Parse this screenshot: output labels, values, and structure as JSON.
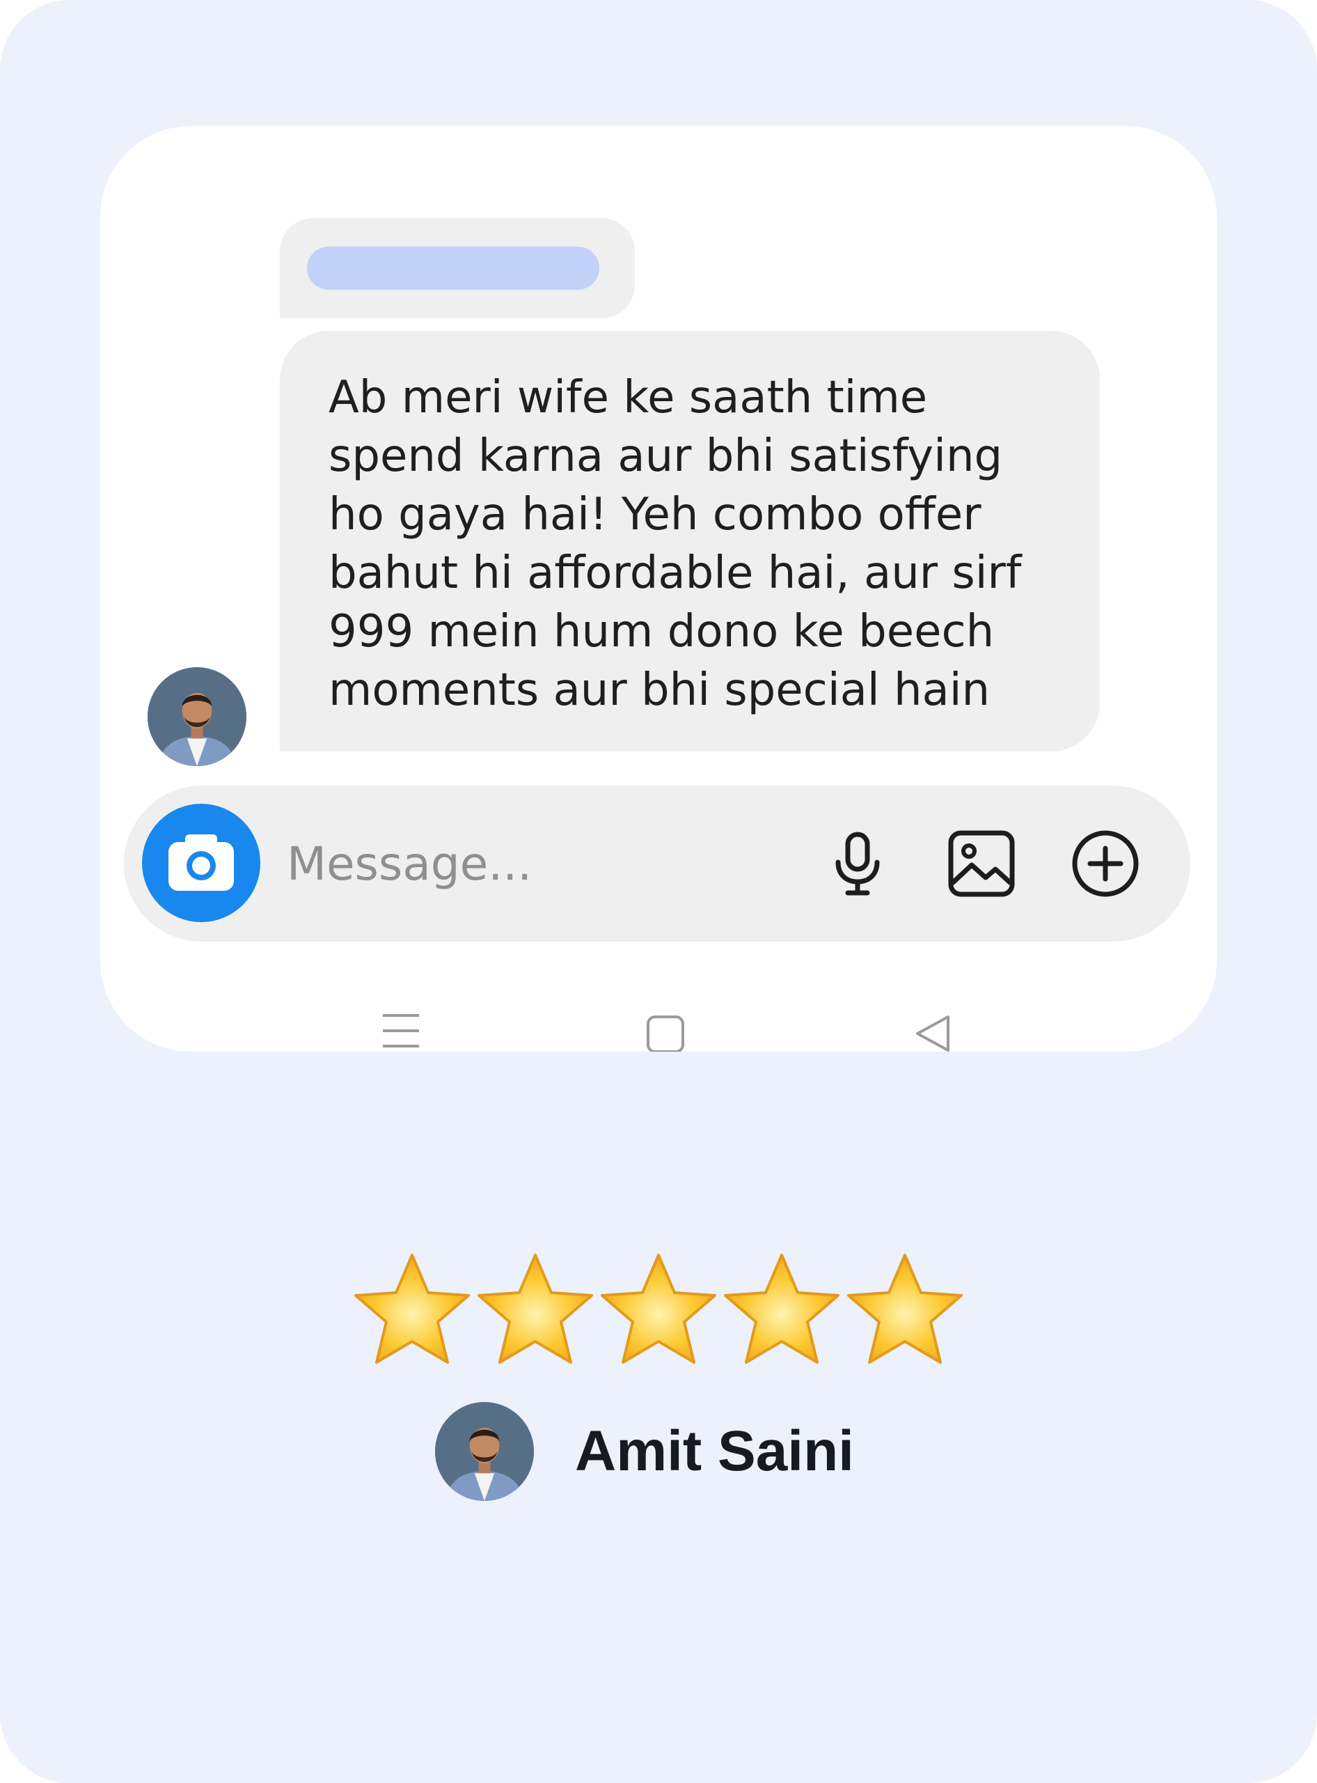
{
  "chat": {
    "message_text": "Ab meri wife ke saath time\nspend karna aur bhi satisfying\nho gaya hai! Yeh combo offer\nbahut hi affordable hai, aur sirf\n999 mein hum dono ke beech\nmoments aur bhi special hain",
    "sender_avatar_icon": "avatar-photo"
  },
  "composer": {
    "placeholder": "Message...",
    "camera_icon": "camera-icon",
    "mic_icon": "microphone-icon",
    "gallery_icon": "image-gallery-icon",
    "add_icon": "plus-circle-icon",
    "camera_button_color": "#1888ee"
  },
  "nav_bar": {
    "menu_icon": "menu-lines-icon",
    "home_icon": "square-home-icon",
    "back_icon": "triangle-back-icon"
  },
  "review": {
    "rating": 5,
    "max_rating": 5,
    "author_name": "Amit Saini"
  },
  "colors": {
    "background": "#ecf1fc",
    "bubble": "#efefef",
    "placeholder_bar": "#c0d2f8",
    "star_fill": "#fcc932"
  }
}
